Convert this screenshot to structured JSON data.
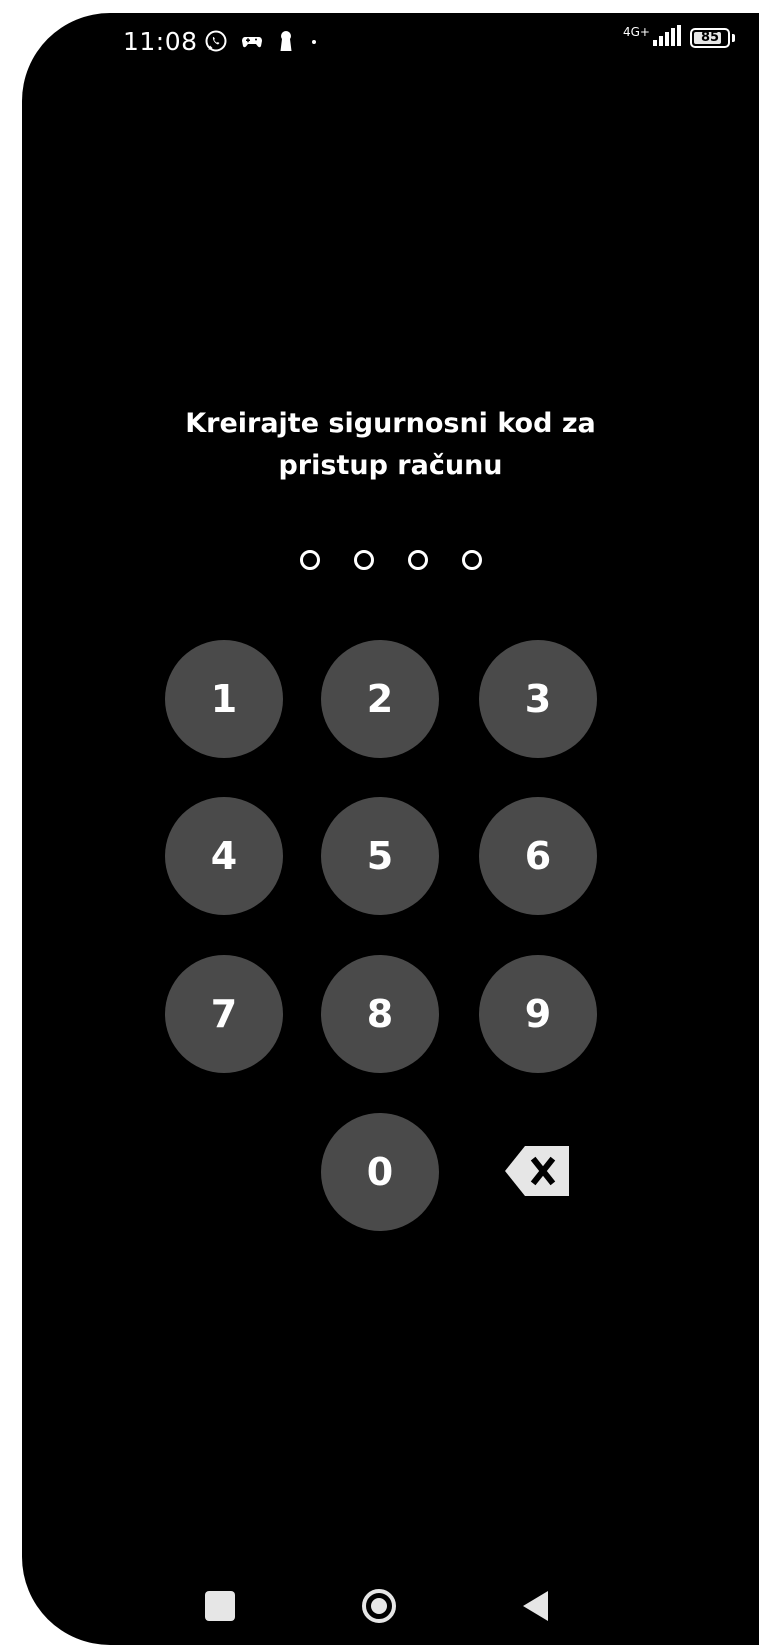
{
  "status_bar": {
    "time": "11:08",
    "network_type": "4G+",
    "battery_level": "85",
    "battery_fraction": 0.85,
    "left_icons": [
      "whatsapp-icon",
      "game-controller-icon",
      "keyhole-icon",
      "notification-dot-icon"
    ],
    "right_icons": [
      "signal-icon",
      "battery-icon"
    ]
  },
  "screen": {
    "title_line1": "Kreirajte sigurnosni kod za",
    "title_line2": "pristup računu",
    "pin_length": 4,
    "pin_entered": 0
  },
  "keypad": {
    "keys": [
      "1",
      "2",
      "3",
      "4",
      "5",
      "6",
      "7",
      "8",
      "9",
      "0"
    ],
    "backspace_icon": "backspace-icon"
  },
  "nav_bar": {
    "buttons": [
      "recents-icon",
      "home-icon",
      "back-icon"
    ]
  },
  "colors": {
    "background": "#000000",
    "key_fill": "#4a4a4a",
    "text": "#ffffff"
  }
}
